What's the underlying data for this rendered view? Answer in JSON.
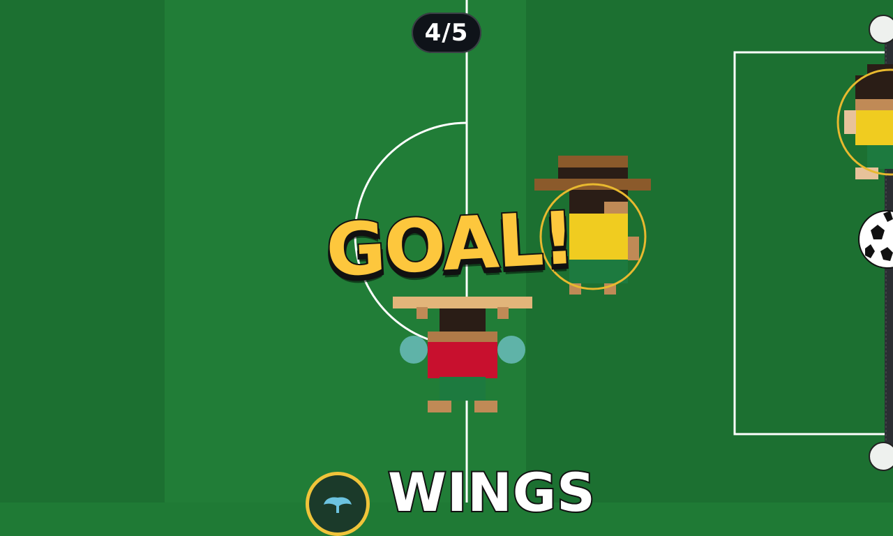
{
  "hud": {
    "goal_counter": "4/5"
  },
  "banner": {
    "goal_text": "GOAL!"
  },
  "team": {
    "name": "WINGS",
    "badge_icon": "wings-icon"
  },
  "colors": {
    "pitch_light": "#22803a",
    "pitch_dark": "#1c6e31",
    "line_white": "#ffffff",
    "goal_yellow": "#fdc73d",
    "selection_ring": "#e8b92f",
    "red_kit": "#c8102e",
    "yellow_kit": "#f0cc20",
    "shorts_green": "#1d7a3f",
    "glove_teal": "#5fb3a8"
  }
}
